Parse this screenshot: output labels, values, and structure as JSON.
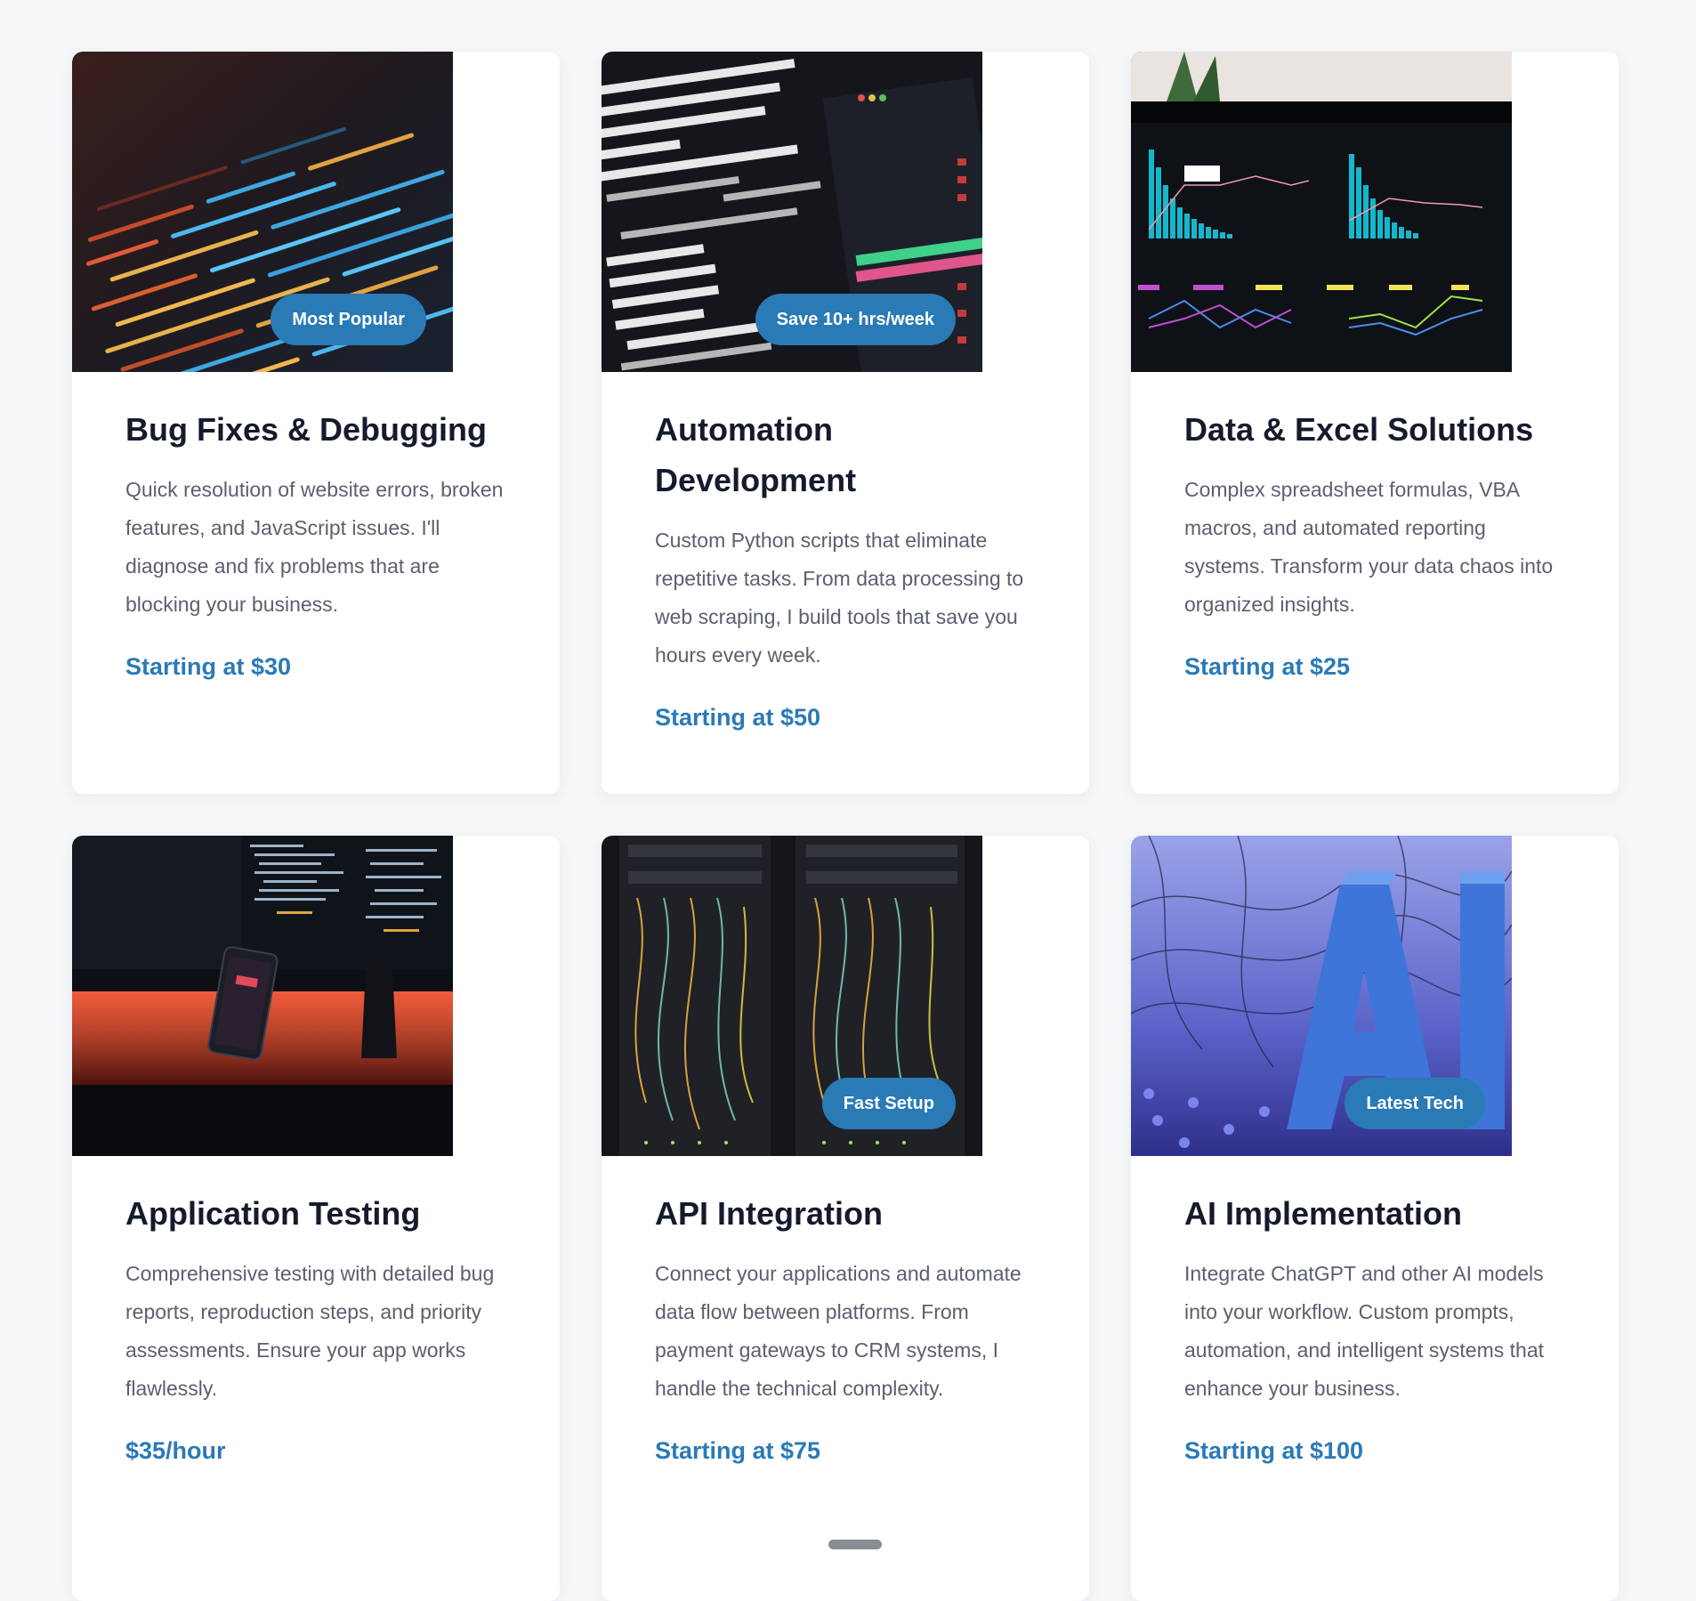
{
  "colors": {
    "accent": "#2a7ab6",
    "title": "#151a2c",
    "text": "#5b6070",
    "background": "#f6f7f9",
    "card": "#ffffff"
  },
  "cards": [
    {
      "image": "code-editor-photo",
      "badge": "Most Popular",
      "title": "Bug Fixes & Debugging",
      "description": "Quick resolution of website errors, broken features, and JavaScript issues. I'll diagnose and fix problems that are blocking your business.",
      "price": "Starting at $30"
    },
    {
      "image": "terminal-photo",
      "badge": "Save 10+ hrs/week",
      "title": "Automation Development",
      "description": "Custom Python scripts that eliminate repetitive tasks. From data processing to web scraping, I build tools that save you hours every week.",
      "price": "Starting at $50"
    },
    {
      "image": "analytics-dashboard-photo",
      "badge": "",
      "title": "Data & Excel Solutions",
      "description": "Complex spreadsheet formulas, VBA macros, and automated reporting systems. Transform your data chaos into organized insights.",
      "price": "Starting at $25"
    },
    {
      "image": "desk-setup-photo",
      "badge": "",
      "title": "Application Testing",
      "description": "Comprehensive testing with detailed bug reports, reproduction steps, and priority assessments. Ensure your app works flawlessly.",
      "price": "$35/hour"
    },
    {
      "image": "server-rack-photo",
      "badge": "Fast Setup",
      "title": "API Integration",
      "description": "Connect your applications and automate data flow between platforms. From payment gateways to CRM systems, I handle the technical complexity.",
      "price": "Starting at $75"
    },
    {
      "image": "ai-letters-photo",
      "badge": "Latest Tech",
      "title": "AI Implementation",
      "description": "Integrate ChatGPT and other AI models into your workflow. Custom prompts, automation, and intelligent systems that enhance your business.",
      "price": "Starting at $100"
    }
  ]
}
